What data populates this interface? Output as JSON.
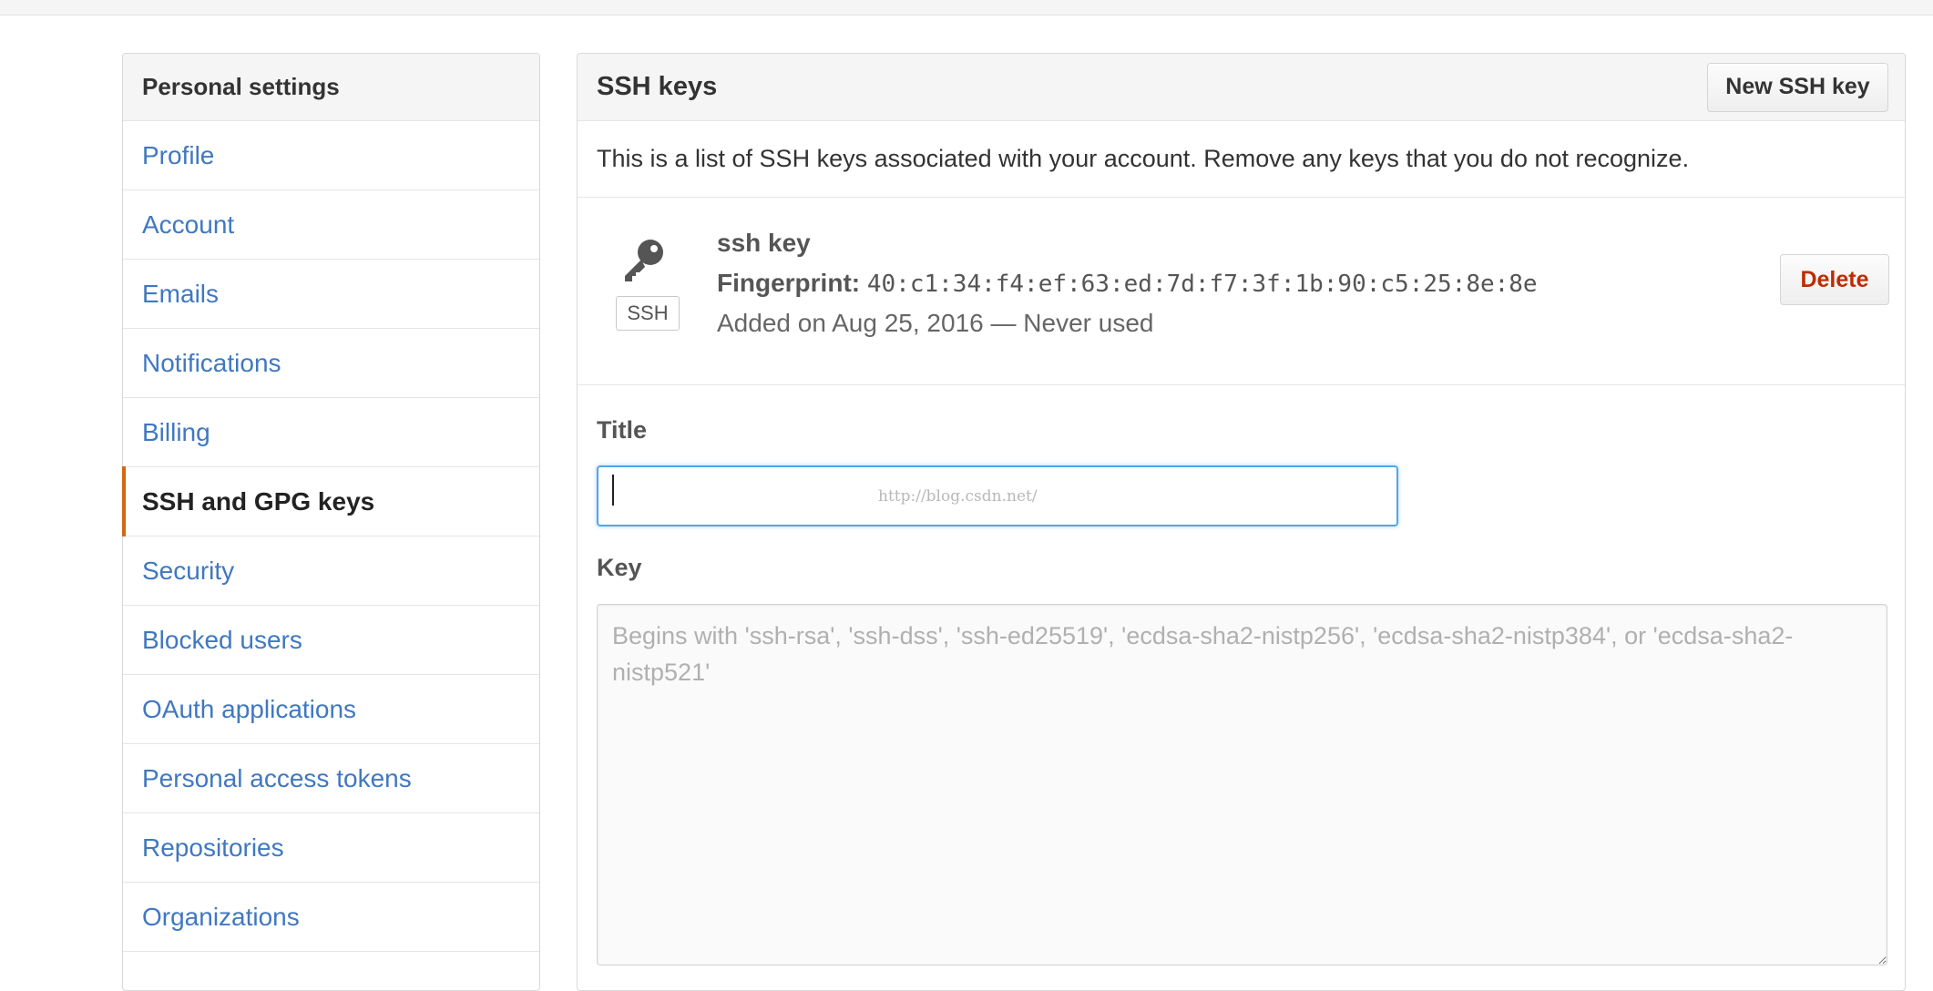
{
  "sidebar": {
    "header": "Personal settings",
    "items": [
      {
        "label": "Profile",
        "selected": false
      },
      {
        "label": "Account",
        "selected": false
      },
      {
        "label": "Emails",
        "selected": false
      },
      {
        "label": "Notifications",
        "selected": false
      },
      {
        "label": "Billing",
        "selected": false
      },
      {
        "label": "SSH and GPG keys",
        "selected": true
      },
      {
        "label": "Security",
        "selected": false
      },
      {
        "label": "Blocked users",
        "selected": false
      },
      {
        "label": "OAuth applications",
        "selected": false
      },
      {
        "label": "Personal access tokens",
        "selected": false
      },
      {
        "label": "Repositories",
        "selected": false
      },
      {
        "label": "Organizations",
        "selected": false
      }
    ]
  },
  "panel": {
    "title": "SSH keys",
    "new_button": "New SSH key",
    "description": "This is a list of SSH keys associated with your account. Remove any keys that you do not recognize.",
    "key": {
      "icon": "key-icon",
      "badge": "SSH",
      "name": "ssh key",
      "fingerprint_label": "Fingerprint:",
      "fingerprint": "40:c1:34:f4:ef:63:ed:7d:f7:3f:1b:90:c5:25:8e:8e",
      "added": "Added on Aug 25, 2016 — Never used",
      "delete_button": "Delete"
    }
  },
  "form": {
    "title_label": "Title",
    "title_value": "",
    "key_label": "Key",
    "key_placeholder": "Begins with 'ssh-rsa', 'ssh-dss', 'ssh-ed25519', 'ecdsa-sha2-nistp256', 'ecdsa-sha2-nistp384', or 'ecdsa-sha2-nistp521'"
  },
  "watermark": "http://blog.csdn.net/",
  "colors": {
    "link": "#4078c0",
    "selected_marker": "#d26911",
    "delete_text": "#bd2c00",
    "focus_border": "#51a7e8"
  }
}
